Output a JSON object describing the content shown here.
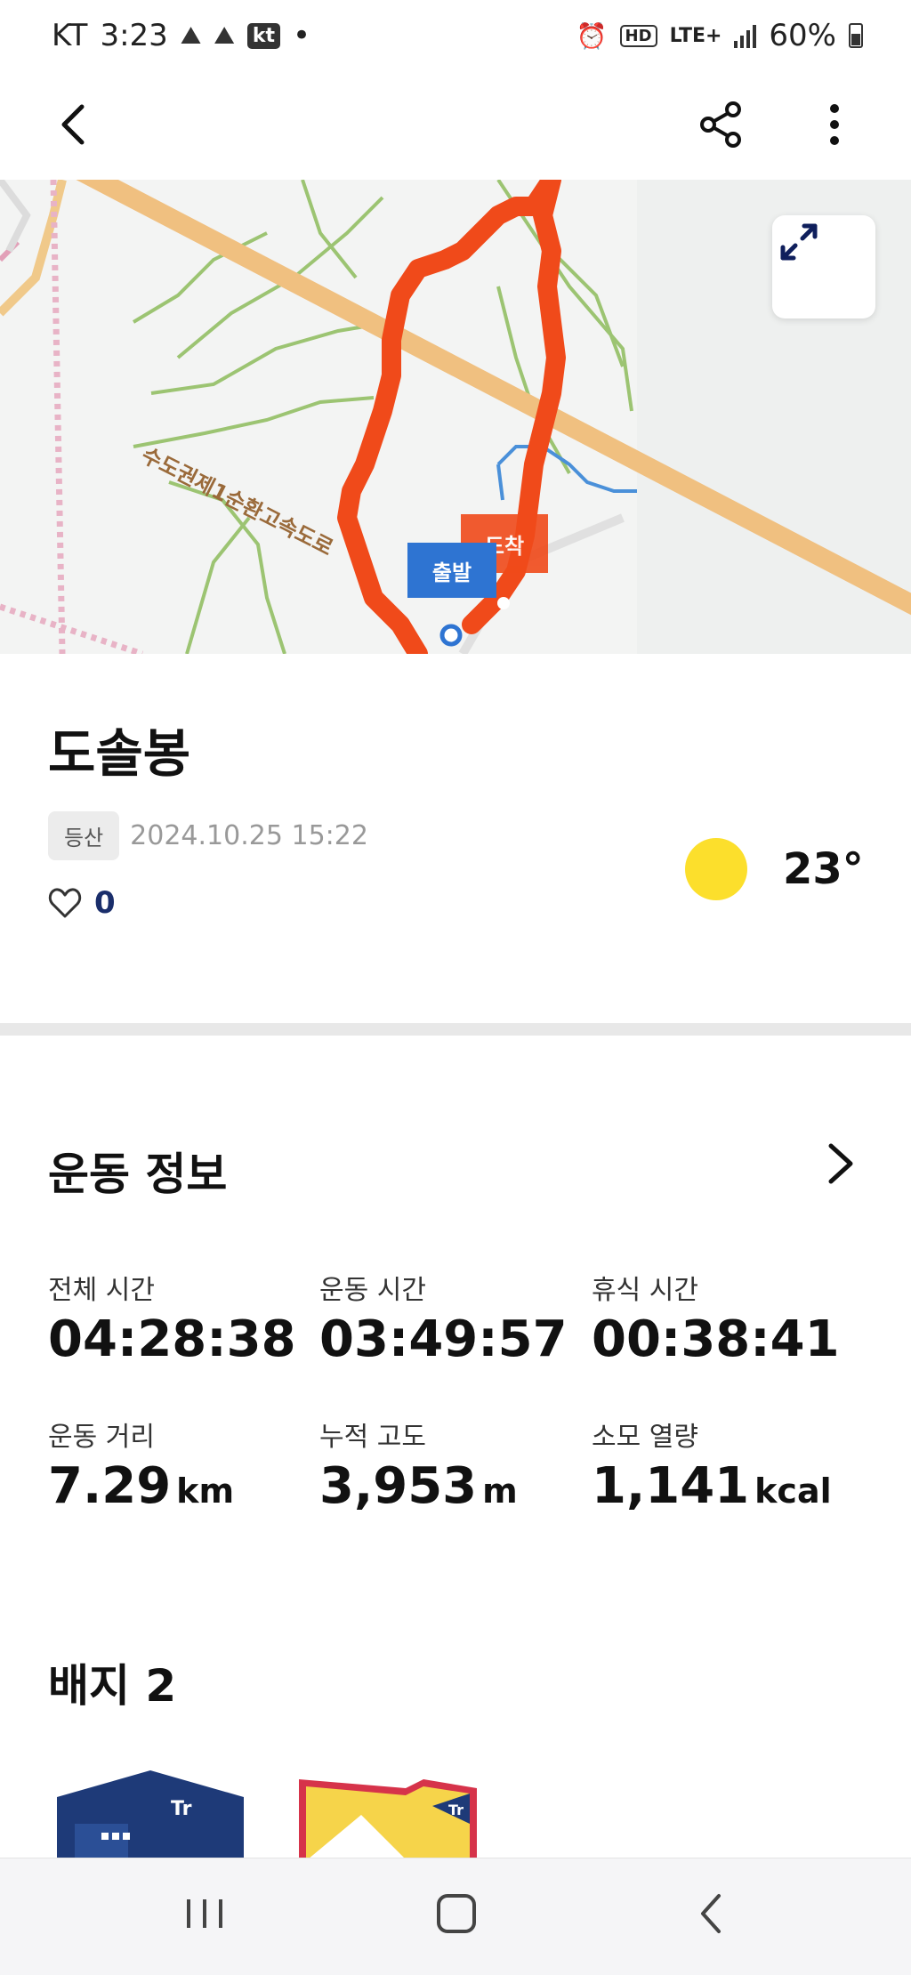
{
  "status_bar": {
    "carrier": "KT",
    "time": "3:23",
    "kt_badge": "kt",
    "dot": "•",
    "hd": "HD",
    "network": "LTE+",
    "battery": "60%"
  },
  "app_bar": {
    "back_icon": "chevron-left-icon",
    "share_icon": "share-icon",
    "more_icon": "more-vertical-icon"
  },
  "map": {
    "road_label": "수도권제1순환고속도로",
    "start_label": "출발",
    "end_label": "도착",
    "expand_icon": "expand-icon",
    "route_color": "#f04a1a",
    "start_color": "#2e74d2"
  },
  "activity": {
    "title": "도솔봉",
    "tag": "등산",
    "datetime": "2024.10.25 15:22",
    "likes": "0",
    "temperature": "23°",
    "weather_icon": "sun-icon"
  },
  "exercise": {
    "section_title": "운동 정보",
    "stats": [
      {
        "label": "전체 시간",
        "value": "04:28:38",
        "unit": ""
      },
      {
        "label": "운동 시간",
        "value": "03:49:57",
        "unit": ""
      },
      {
        "label": "휴식 시간",
        "value": "00:38:41",
        "unit": ""
      },
      {
        "label": "운동 거리",
        "value": "7.29",
        "unit": "km"
      },
      {
        "label": "누적 고도",
        "value": "3,953",
        "unit": "m"
      },
      {
        "label": "소모 열량",
        "value": "1,141",
        "unit": "kcal"
      }
    ]
  },
  "badges": {
    "title": "배지 2"
  },
  "nav_bar": {
    "recents_icon": "recents-icon",
    "home_icon": "home-icon",
    "back_icon": "back-icon"
  }
}
